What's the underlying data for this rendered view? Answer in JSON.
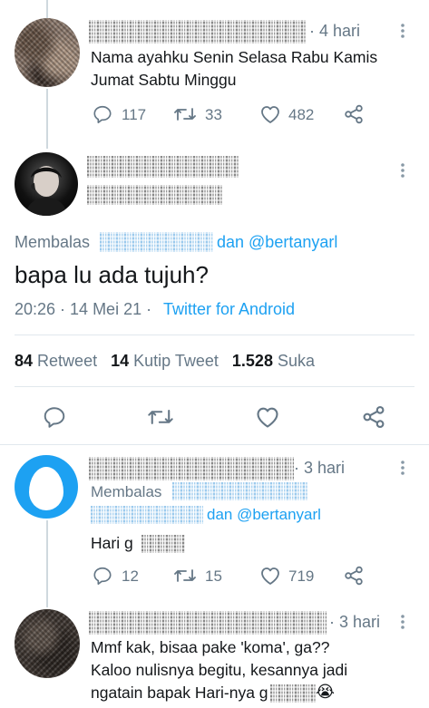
{
  "tweet1": {
    "time": "· 4 hari",
    "text_line1": "Nama ayahku Senin Selasa Rabu Kamis",
    "text_line2": "Jumat Sabtu Minggu",
    "replies": "117",
    "retweets": "33",
    "likes": "482"
  },
  "main_tweet": {
    "reply_prefix": "Membalas",
    "reply_suffix": "dan @bertanyarl",
    "text": "bapa lu ada tujuh?",
    "date": "20:26 · 14 Mei 21 ·",
    "source": "Twitter for Android",
    "retweet_count": "84",
    "retweet_label": "Retweet",
    "quote_count": "14",
    "quote_label": "Kutip Tweet",
    "like_count": "1.528",
    "like_label": "Suka"
  },
  "tweet3": {
    "time": "· 3 hari",
    "reply_prefix": "Membalas",
    "reply_suffix": "dan @bertanyarl",
    "text": "Hari g",
    "replies": "12",
    "retweets": "15",
    "likes": "719"
  },
  "tweet4": {
    "time": "· 3 hari",
    "line1": "Mmf kak, bisaa pake 'koma', ga??",
    "line2": "Kaloo nulisnya begitu, kesannya jadi",
    "line3": "ngatain bapak Hari-nya g",
    "emoji": "😭"
  },
  "colors": {
    "accent": "#1da1f2",
    "secondary_text": "#657786",
    "primary_text": "#14171a",
    "divider": "#e1e8ed"
  }
}
